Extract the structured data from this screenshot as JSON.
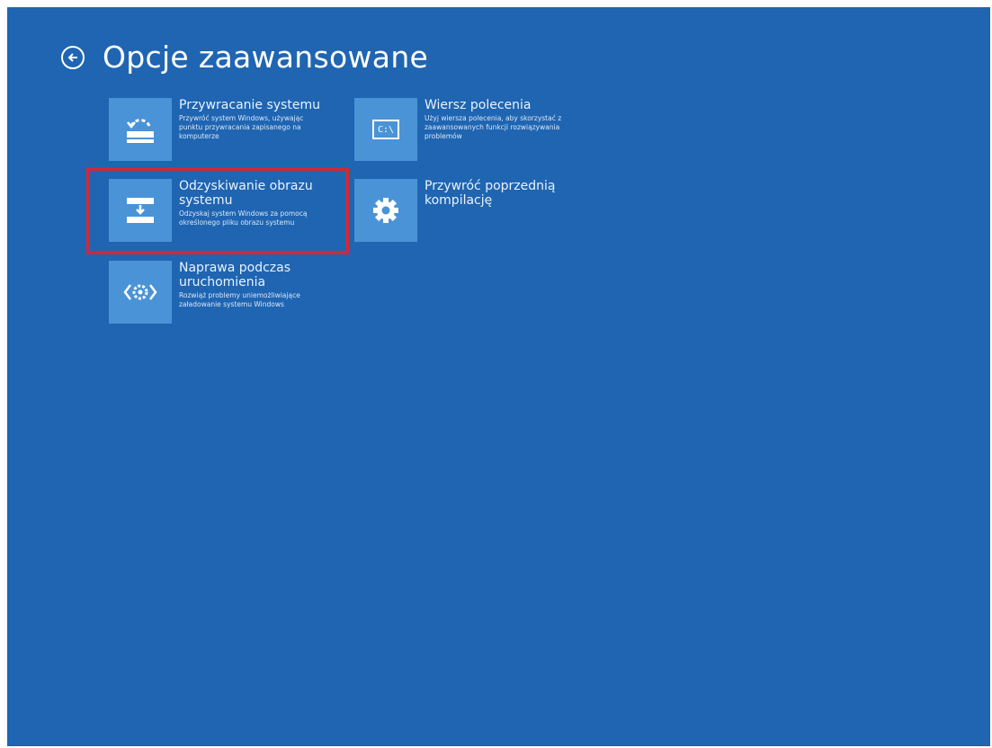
{
  "header": {
    "title": "Opcje zaawansowane",
    "back_icon": "arrow-left-circle-icon"
  },
  "tiles": [
    {
      "title": "Przywracanie systemu",
      "description": "Przywróć system Windows, używając punktu przywracania zapisanego na komputerze",
      "icon": "system-restore-icon"
    },
    {
      "title": "Wiersz polecenia",
      "description": "Użyj wiersza polecenia, aby skorzystać z zaawansowanych funkcji rozwiązywania problemów",
      "icon": "command-prompt-icon",
      "icon_text": "C:\\"
    },
    {
      "title": "Odzyskiwanie obrazu systemu",
      "description": "Odzyskaj system Windows za pomocą określonego pliku obrazu systemu",
      "icon": "system-image-recovery-icon"
    },
    {
      "title": "Przywróć poprzednią kompilację",
      "description": "",
      "icon": "gear-icon"
    },
    {
      "title": "Naprawa podczas uruchomienia",
      "description": "Rozwiąż problemy uniemożliwiające załadowanie systemu Windows",
      "icon": "startup-repair-icon"
    }
  ],
  "colors": {
    "background": "#1f65b2",
    "tile_icon": "#4a93d6",
    "highlight": "#cc2a3a"
  }
}
